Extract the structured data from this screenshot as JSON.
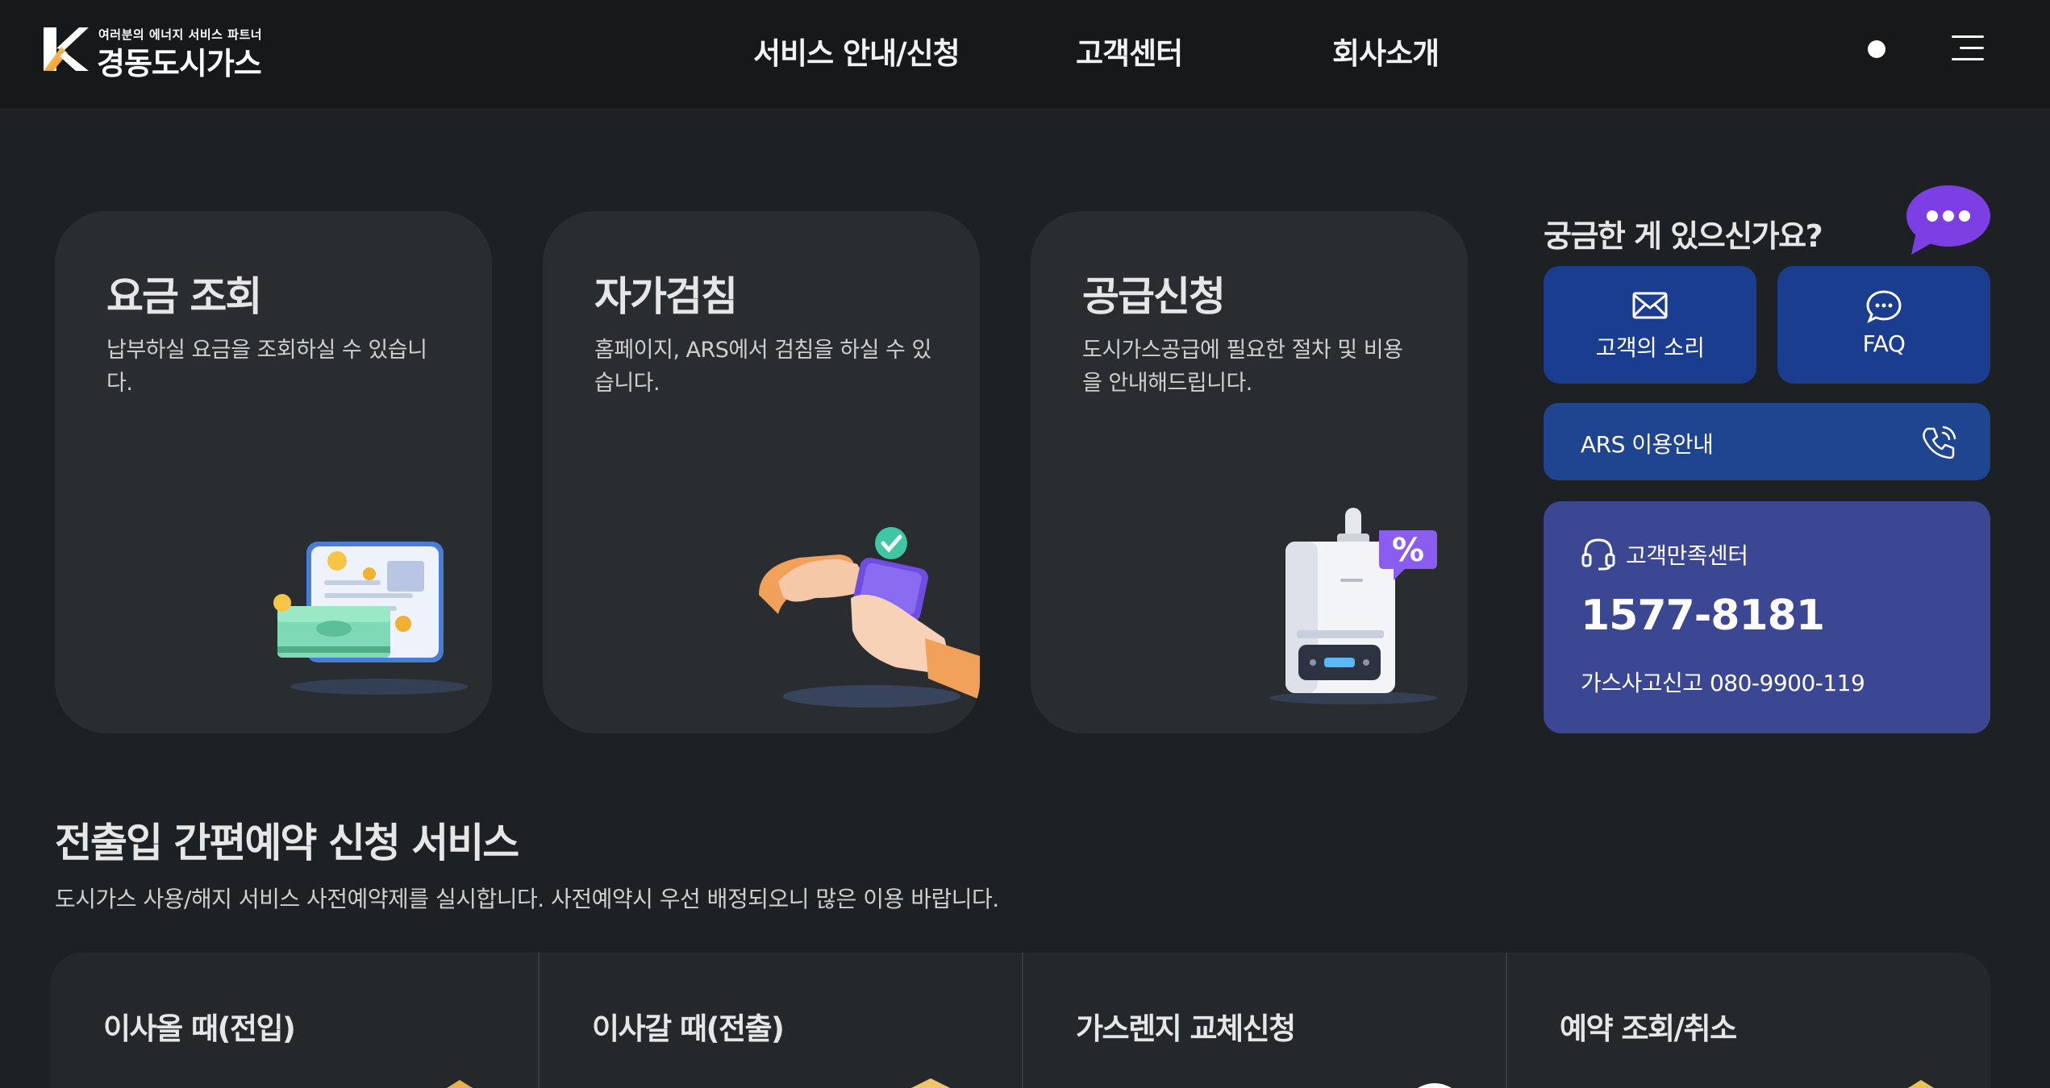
{
  "header": {
    "logo": {
      "tagline": "여러분의 에너지 서비스 파트너",
      "name": "경동도시가스"
    },
    "nav": [
      "서비스 안내/신청",
      "고객센터",
      "회사소개"
    ]
  },
  "cards": [
    {
      "title": "요금 조회",
      "desc": "납부하실 요금을 조회하실 수 있습니다.",
      "icon": "money-card-icon"
    },
    {
      "title": "자가검침",
      "desc": "홈페이지, ARS에서 검침을 하실 수 있습니다.",
      "icon": "hand-phone-check-icon"
    },
    {
      "title": "공급신청",
      "desc": "도시가스공급에 필요한 절차 및 비용을 안내해드립니다.",
      "icon": "boiler-percent-icon"
    }
  ],
  "side": {
    "title": "궁금한 게 있으신가요?",
    "voice_label": "고객의 소리",
    "faq_label": "FAQ",
    "ars_label": "ARS 이용안내",
    "csc": {
      "label": "고객만족센터",
      "phone": "1577-8181",
      "gas_report": "가스사고신고 080-9900-119"
    }
  },
  "section": {
    "title": "전출입 간편예약 신청 서비스",
    "desc": "도시가스 사용/해지 서비스 사전예약제를 실시합니다. 사전예약시 우선 배정되오니 많은 이용 바랍니다.",
    "items": [
      "이사올 때(전입)",
      "이사갈 때(전출)",
      "가스렌지 교체신청",
      "예약 조회/취소"
    ]
  },
  "colors": {
    "background": "#1e2124",
    "header": "#16181a",
    "card": "#2a2d30",
    "blue_button": "#1a3d8f",
    "ars_button": "#1f4590",
    "csc_panel": "#3b4792",
    "chat_purple": "#7b3fe4"
  }
}
